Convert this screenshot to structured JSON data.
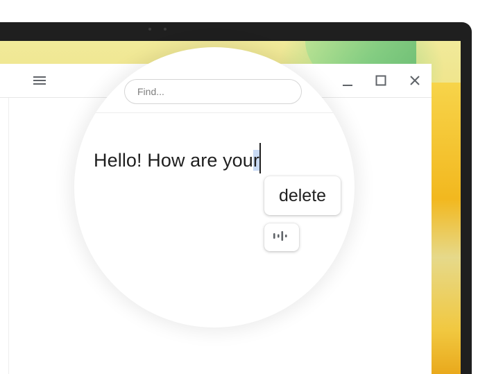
{
  "search": {
    "placeholder": "Find..."
  },
  "editor": {
    "text_before": "Hello! How are you",
    "text_selected": "r"
  },
  "suggestion": {
    "delete_label": "delete"
  },
  "icons": {
    "menu": "hamburger-menu-icon",
    "minimize": "minimize-icon",
    "maximize": "maximize-icon",
    "close": "close-icon",
    "voice": "voice-waveform-icon"
  },
  "colors": {
    "selection": "#c8daf5",
    "bezel": "#1f1f1f",
    "wallpaper_yellow": "#f4c542",
    "wallpaper_green": "#7fcb80"
  }
}
